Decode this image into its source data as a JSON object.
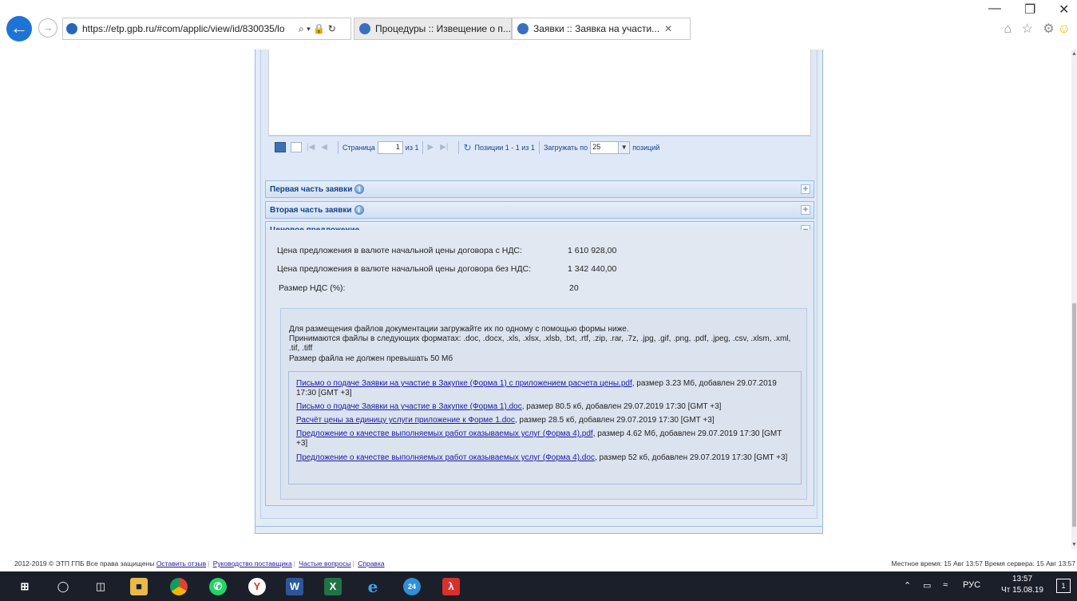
{
  "browser": {
    "url": "https://etp.gpb.ru/#com/applic/view/id/830035/lo",
    "addr_controls": "⌕ ▾ 🔒 ↻",
    "tabs": [
      {
        "label": "Процедуры :: Извещение о п..."
      },
      {
        "label": "Заявки :: Заявка на участи...",
        "close": "✕"
      }
    ],
    "window_controls": {
      "minimize": "—",
      "restore": "❐",
      "close": "✕"
    },
    "tool_icons": "⌂ ☆ ⚙"
  },
  "pager": {
    "page_label": "Страница",
    "page_value": "1",
    "of_label": "из 1",
    "positions_label": "Позиции 1 - 1 из 1",
    "load_label": "Загружать по",
    "per_page": "25",
    "positions_suffix": "позиций"
  },
  "panels": [
    {
      "title": "Первая часть заявки",
      "toggle": "+",
      "has_info": true
    },
    {
      "title": "Вторая часть заявки",
      "toggle": "+",
      "has_info": true
    },
    {
      "title": "Ценовое предложение",
      "toggle": "−",
      "has_info": false
    }
  ],
  "price": {
    "with_vat_label": "Цена предложения в валюте начальной цены договора с НДС:",
    "with_vat_value": "1 610 928,00",
    "without_vat_label": "Цена предложения в валюте начальной цены договора без НДС:",
    "without_vat_value": "1 342 440,00",
    "vat_label": "Размер НДС (%):",
    "vat_value": "20"
  },
  "upload": {
    "hint1": "Для размещения файлов документации загружайте их по одному с помощью формы ниже.",
    "hint2": "Принимаются файлы в следующих форматах: .doc, .docx, .xls, .xlsx, .xlsb, .txt, .rtf, .zip, .rar, .7z, .jpg, .gif, .png, .pdf, .jpeg, .csv, .xlsm, .xml, .tif, .tiff",
    "hint3": "Размер файла не должен превышать 50 Мб",
    "files": [
      {
        "name": "Письмо о подаче Заявки на участие в Закупке (Форма 1) с приложением расчета цены.pdf",
        "meta": ", размер 3.23 Мб, добавлен 29.07.2019 17:30 [GMT +3]"
      },
      {
        "name": "Письмо о подаче Заявки на участие в Закупке (Форма 1).doc",
        "meta": ", размер 80.5 кб, добавлен 29.07.2019 17:30 [GMT +3]"
      },
      {
        "name": "Расчёт цены за единицу услуги приложение к Форме 1.doc",
        "meta": ", размер 28.5 кб, добавлен 29.07.2019 17:30 [GMT +3]"
      },
      {
        "name": "Предложение о качестве выполняемых работ оказываемых услуг (Форма 4).pdf",
        "meta": ", размер 4.62 Мб, добавлен 29.07.2019 17:30 [GMT +3]"
      },
      {
        "name": "Предложение о качестве выполняемых работ оказываемых услуг (Форма 4).doc",
        "meta": ", размер 52 кб, добавлен 29.07.2019 17:30 [GMT +3]"
      }
    ]
  },
  "footer": {
    "copyright": "2012-2019 © ЭТП ГПБ Все права защищены",
    "links": [
      "Оставить отзыв",
      "Руководство поставщика",
      "Частые вопросы",
      "Справка"
    ],
    "time": "Местное время: 15 Авг 13:57 Время сервера: 15 Авг 13:57"
  },
  "taskbar": {
    "lang": "РУС",
    "time": "13:57",
    "date": "Чт 15.08.19",
    "notifications": "1",
    "apps": [
      "start-icon",
      "search-icon",
      "task-view-icon",
      "file-explorer-icon",
      "chrome-icon",
      "whatsapp-icon",
      "yandex-icon",
      "word-icon",
      "excel-icon",
      "ie-icon",
      "app-24-icon",
      "acrobat-icon"
    ]
  }
}
